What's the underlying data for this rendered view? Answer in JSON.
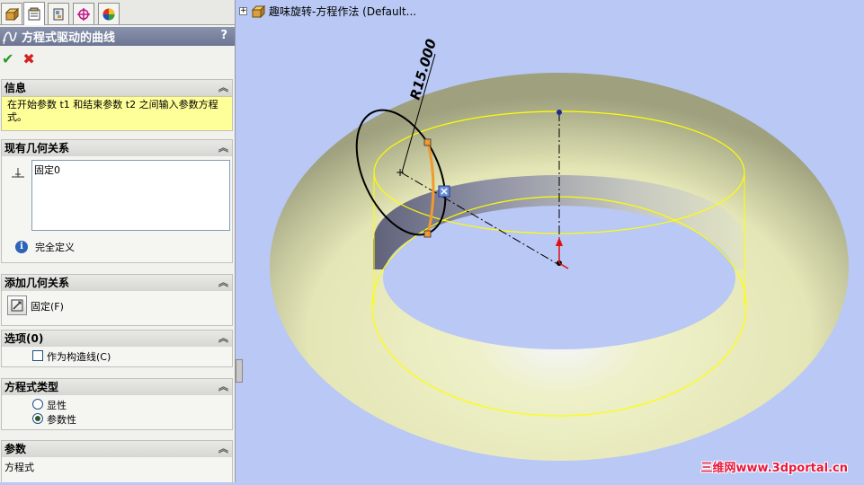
{
  "tabs": [
    {
      "name": "FeatureManager"
    },
    {
      "name": "PropertyManager"
    },
    {
      "name": "ConfigurationManager"
    },
    {
      "name": "DimXpertManager"
    },
    {
      "name": "DisplayManager"
    }
  ],
  "pm": {
    "title": "方程式驱动的曲线",
    "help": "?"
  },
  "groups": {
    "info": {
      "title": "信息",
      "message": "在开始参数 t1 和结束参数 t2 之间输入参数方程式。"
    },
    "existing": {
      "title": "现有几何关系",
      "relations": [
        "固定0"
      ],
      "status": "完全定义"
    },
    "add": {
      "title": "添加几何关系",
      "fix_label": "固定(F)"
    },
    "options": {
      "title": "选项(0)",
      "construction_label": "作为构造线(C)"
    },
    "eq_type": {
      "title": "方程式类型",
      "explicit_label": "显性",
      "param_label": "参数性",
      "selected": "参数性"
    },
    "params": {
      "title": "参数",
      "equation_label": "方程式"
    }
  },
  "viewport": {
    "tree_text": "趣味旋转-方程作法 (Default...",
    "dimension": "R15.000",
    "watermark": "三维网www.3dportal.cn"
  },
  "colors": {
    "torus": "#f0f0c8",
    "background": "#b9c8f4",
    "selected_edge": "#ffff00",
    "sketch_arc": "#f09a30",
    "watermark": "#e8183c"
  }
}
